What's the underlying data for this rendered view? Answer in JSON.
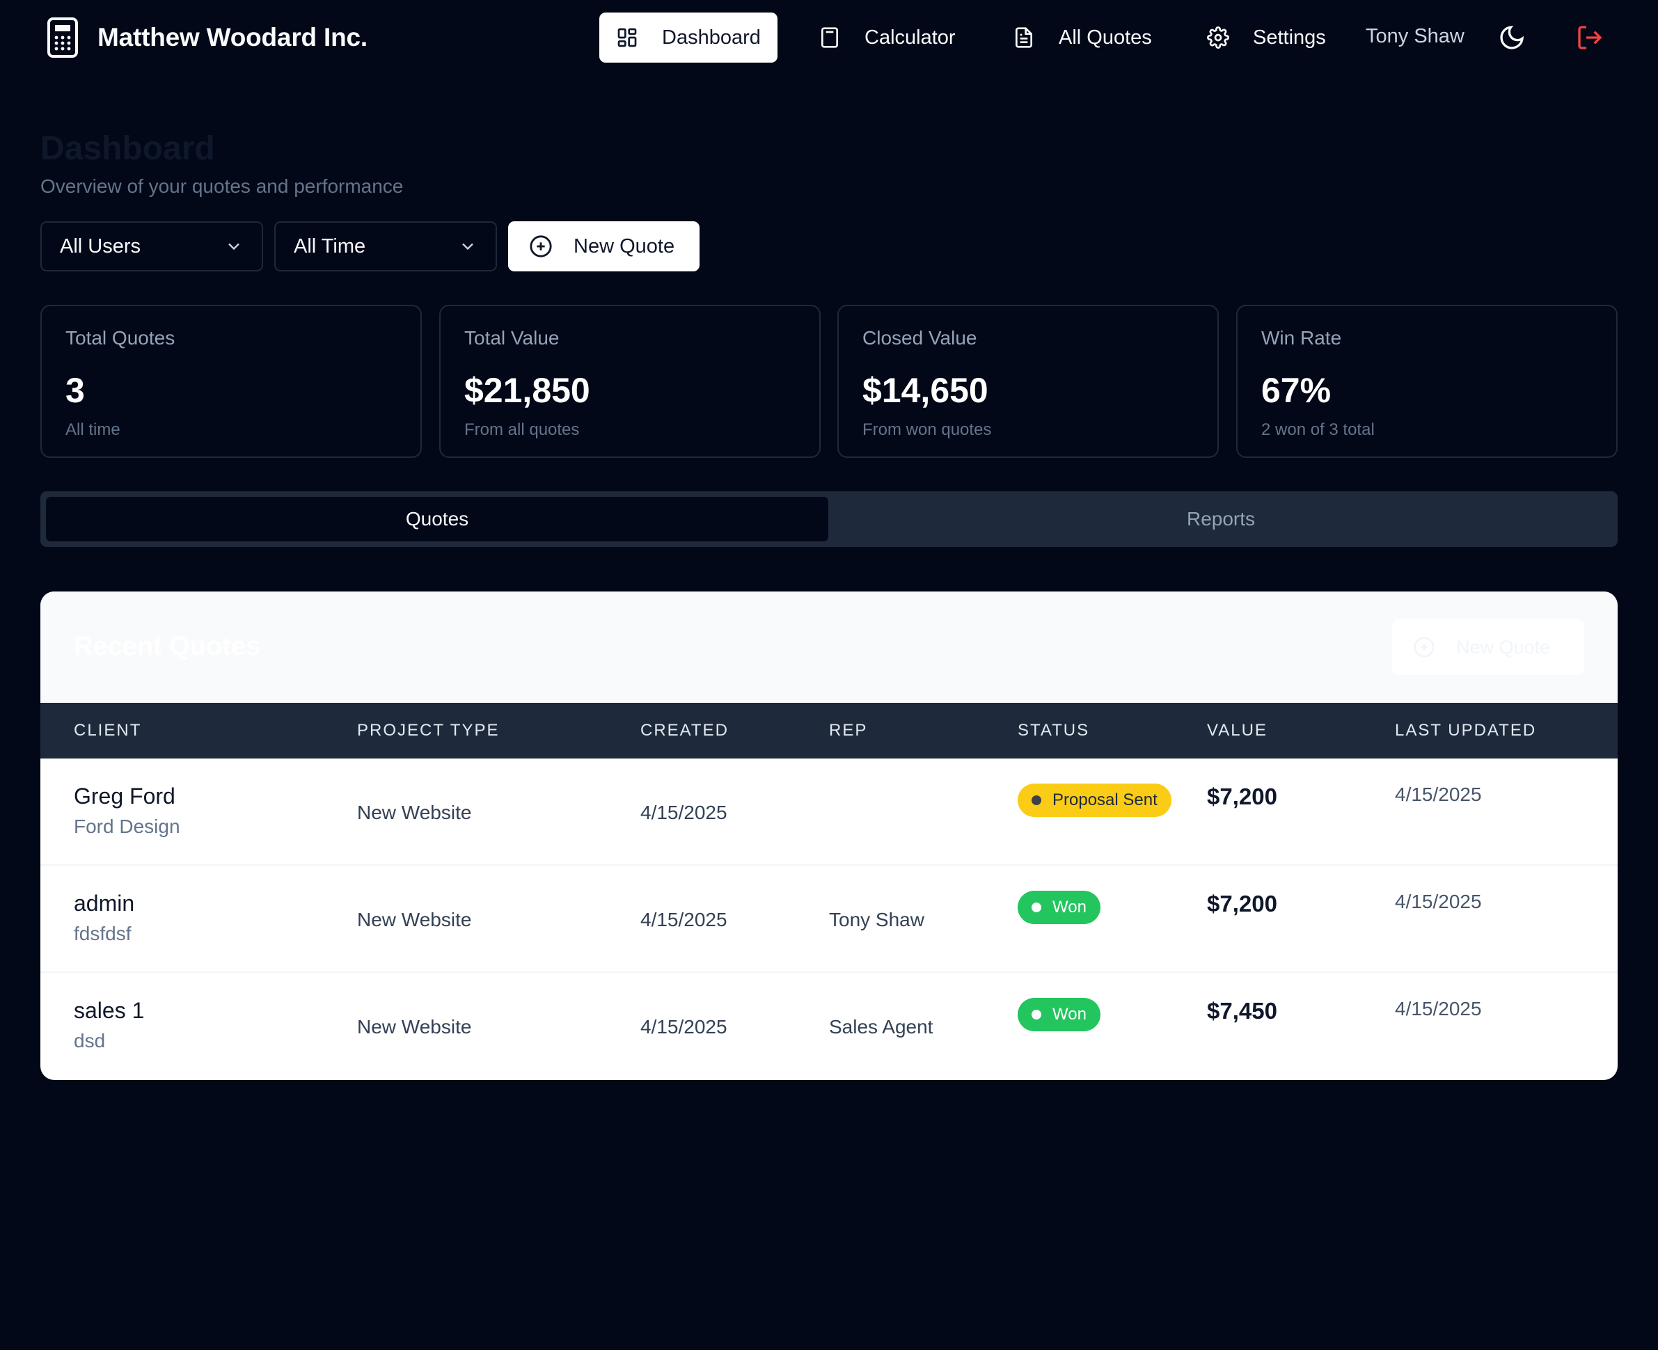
{
  "brand": {
    "name": "Matthew Woodard Inc.",
    "icon": "calculator-icon"
  },
  "nav": {
    "items": [
      {
        "label": "Dashboard",
        "icon": "dashboard-grid-icon",
        "active": true
      },
      {
        "label": "Calculator",
        "icon": "calculator-icon"
      },
      {
        "label": "All Quotes",
        "icon": "file-text-icon"
      },
      {
        "label": "Settings",
        "icon": "gear-icon"
      }
    ],
    "user": "Tony Shaw",
    "theme_icon": "moon-icon",
    "logout_icon": "logout-icon"
  },
  "page": {
    "title": "Dashboard",
    "subtitle": "Overview of your quotes and performance"
  },
  "filters": {
    "user_select": "All Users",
    "time_select": "All Time",
    "new_quote": "New Quote"
  },
  "stats": [
    {
      "label": "Total Quotes",
      "value": "3",
      "sub": "All time"
    },
    {
      "label": "Total Value",
      "value": "$21,850",
      "sub": "From all quotes"
    },
    {
      "label": "Closed Value",
      "value": "$14,650",
      "sub": "From won quotes"
    },
    {
      "label": "Win Rate",
      "value": "67%",
      "sub": "2 won of 3 total"
    }
  ],
  "tabs": [
    {
      "label": "Quotes",
      "active": true
    },
    {
      "label": "Reports",
      "active": false
    }
  ],
  "recent": {
    "title": "Recent Quotes",
    "new_quote": "New Quote",
    "columns": [
      "CLIENT",
      "PROJECT TYPE",
      "CREATED",
      "REP",
      "STATUS",
      "VALUE",
      "LAST UPDATED"
    ],
    "rows": [
      {
        "client": "Greg Ford",
        "company": "Ford Design",
        "project": "New Website",
        "created": "4/15/2025",
        "rep": "",
        "status": "Proposal Sent",
        "value": "$7,200",
        "updated": "4/15/2025"
      },
      {
        "client": "admin",
        "company": "fdsfdsf",
        "project": "New Website",
        "created": "4/15/2025",
        "rep": "Tony Shaw",
        "status": "Won",
        "value": "$7,200",
        "updated": "4/15/2025"
      },
      {
        "client": "sales 1",
        "company": "dsd",
        "project": "New Website",
        "created": "4/15/2025",
        "rep": "Sales Agent",
        "status": "Won",
        "value": "$7,450",
        "updated": "4/15/2025"
      }
    ]
  },
  "colors": {
    "background": "#020817",
    "proposal_badge": "#facc15",
    "won_badge": "#22c55e",
    "logout": "#ef4444"
  }
}
